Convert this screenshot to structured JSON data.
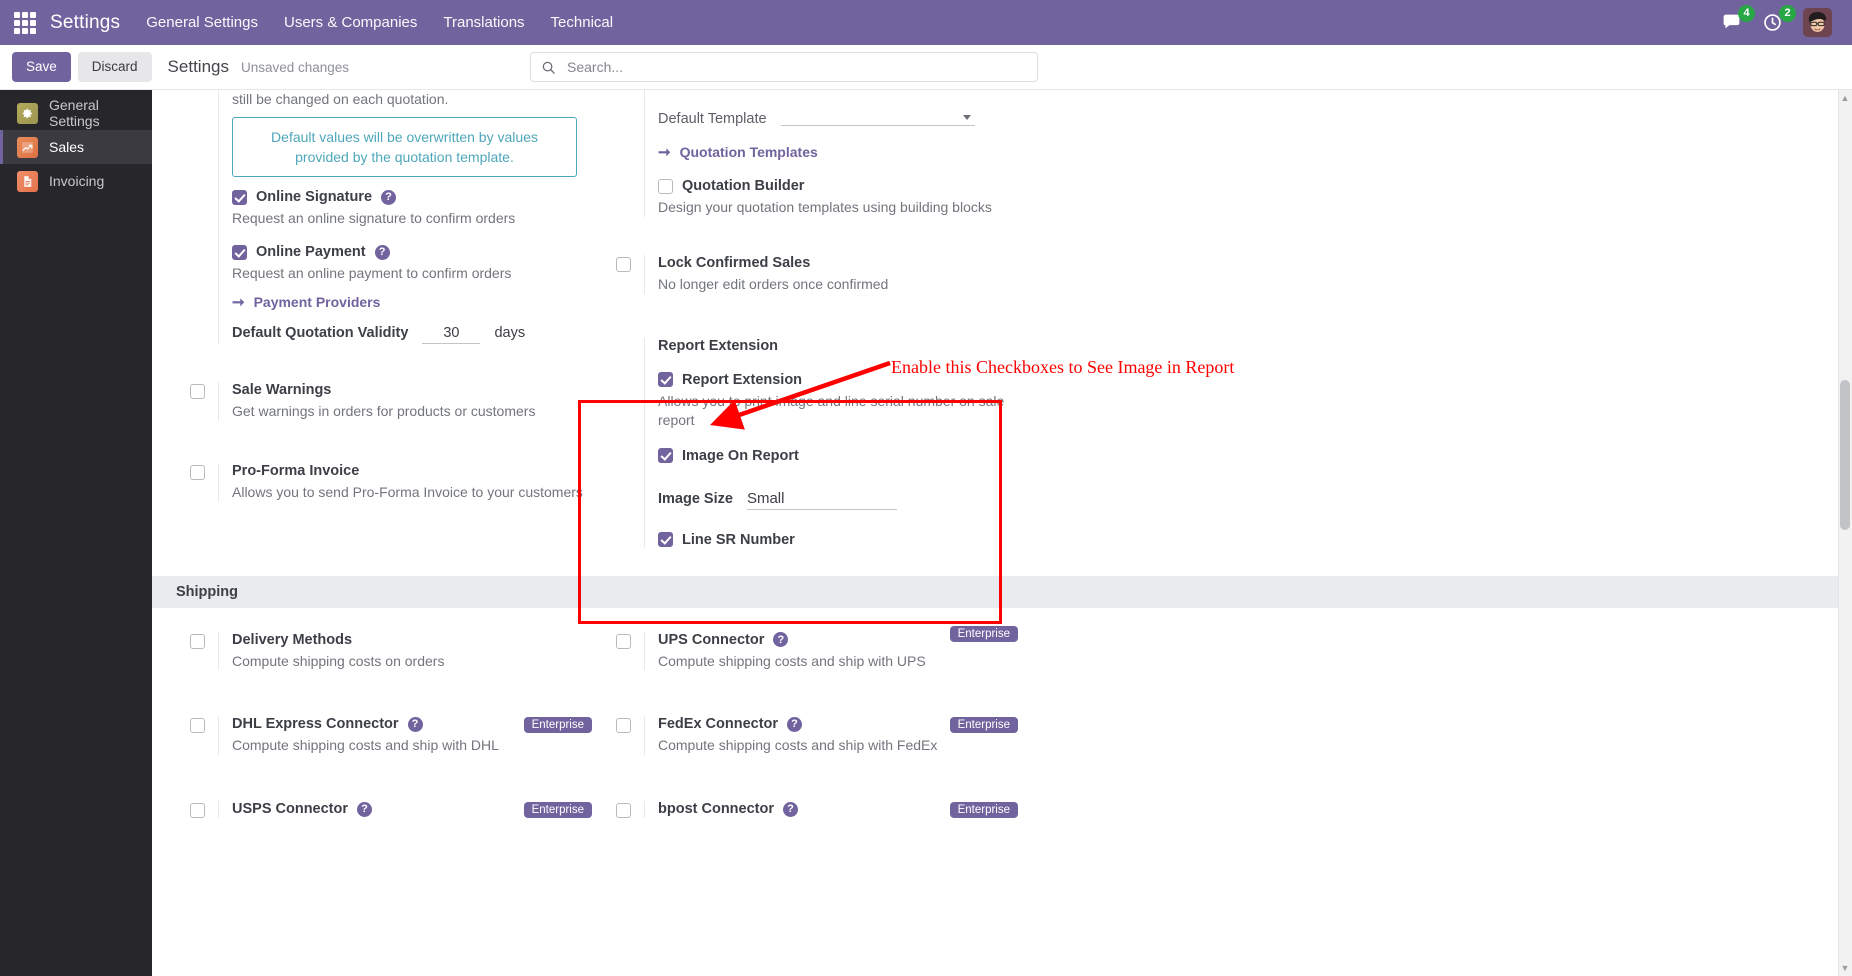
{
  "navbar": {
    "apps_icon": "apps-grid-icon",
    "brand": "Settings",
    "menu": [
      {
        "label": "General Settings"
      },
      {
        "label": "Users & Companies"
      },
      {
        "label": "Translations"
      },
      {
        "label": "Technical"
      }
    ],
    "messages_icon": "chat-bubble-icon",
    "messages_count": "4",
    "activities_icon": "clock-icon",
    "activities_count": "2",
    "avatar": "user-avatar"
  },
  "control_panel": {
    "save_label": "Save",
    "discard_label": "Discard",
    "title": "Settings",
    "status": "Unsaved changes",
    "search_placeholder": "Search...",
    "search_value": "",
    "search_icon": "search-icon"
  },
  "sidebar": {
    "items": [
      {
        "label": "General Settings",
        "icon": "gear-icon",
        "active": false
      },
      {
        "label": "Sales",
        "icon": "sales-chart-icon",
        "active": true
      },
      {
        "label": "Invoicing",
        "icon": "invoice-document-icon",
        "active": false
      }
    ]
  },
  "quotations": {
    "cut_text": "still be changed on each quotation.",
    "alert": "Default values will be overwritten by values provided by the quotation template.",
    "online_signature": {
      "label": "Online Signature",
      "help": "Request an online signature to confirm orders",
      "checked": true
    },
    "online_payment": {
      "label": "Online Payment",
      "help": "Request an online payment to confirm orders",
      "checked": true
    },
    "payment_providers_link": "Payment Providers",
    "quotation_validity": {
      "label": "Default Quotation Validity",
      "value": "30",
      "suffix": "days"
    },
    "default_template": {
      "label": "Default Template",
      "value": ""
    },
    "quotation_templates_link": "Quotation Templates",
    "quotation_builder": {
      "label": "Quotation Builder",
      "help": "Design your quotation templates using building blocks",
      "checked": false
    },
    "sale_warnings": {
      "label": "Sale Warnings",
      "help": "Get warnings in orders for products or customers",
      "checked": false
    },
    "lock_confirmed_sales": {
      "label": "Lock Confirmed Sales",
      "help": "No longer edit orders once confirmed",
      "checked": false
    },
    "pro_forma_invoice": {
      "label": "Pro-Forma Invoice",
      "help": "Allows you to send Pro-Forma Invoice to your customers",
      "checked": false
    }
  },
  "report_extension": {
    "section_title": "Report Extension",
    "toggle": {
      "label": "Report Extension",
      "help": "Allows you to print image and line serial number on sale report",
      "checked": true
    },
    "image_on_report": {
      "label": "Image On Report",
      "checked": true
    },
    "image_size": {
      "label": "Image Size",
      "value": "Small"
    },
    "line_sr_number": {
      "label": "Line SR Number",
      "checked": true
    },
    "highlight_color": "#ff0000"
  },
  "annotation": {
    "text": "Enable this Checkboxes to See Image in Report",
    "color": "#ff0000"
  },
  "shipping": {
    "section_title": "Shipping",
    "enterprise_badge": "Enterprise",
    "items": [
      {
        "label": "Delivery Methods",
        "help": "Compute shipping costs on orders",
        "checked": false,
        "badge": false,
        "qmark": false
      },
      {
        "label": "UPS Connector",
        "help": "Compute shipping costs and ship with UPS",
        "checked": false,
        "badge": true,
        "qmark": true
      },
      {
        "label": "DHL Express Connector",
        "help": "Compute shipping costs and ship with DHL",
        "checked": false,
        "badge": true,
        "qmark": true
      },
      {
        "label": "FedEx Connector",
        "help": "Compute shipping costs and ship with FedEx",
        "checked": false,
        "badge": true,
        "qmark": true
      },
      {
        "label": "USPS Connector",
        "help": "",
        "checked": false,
        "badge": true,
        "qmark": true
      },
      {
        "label": "bpost Connector",
        "help": "",
        "checked": false,
        "badge": true,
        "qmark": true
      }
    ]
  },
  "theme": {
    "brand_purple": "#71639e",
    "sidebar_bg": "#27262b",
    "info_teal": "#4da7bb",
    "badge_green": "#28a745"
  }
}
